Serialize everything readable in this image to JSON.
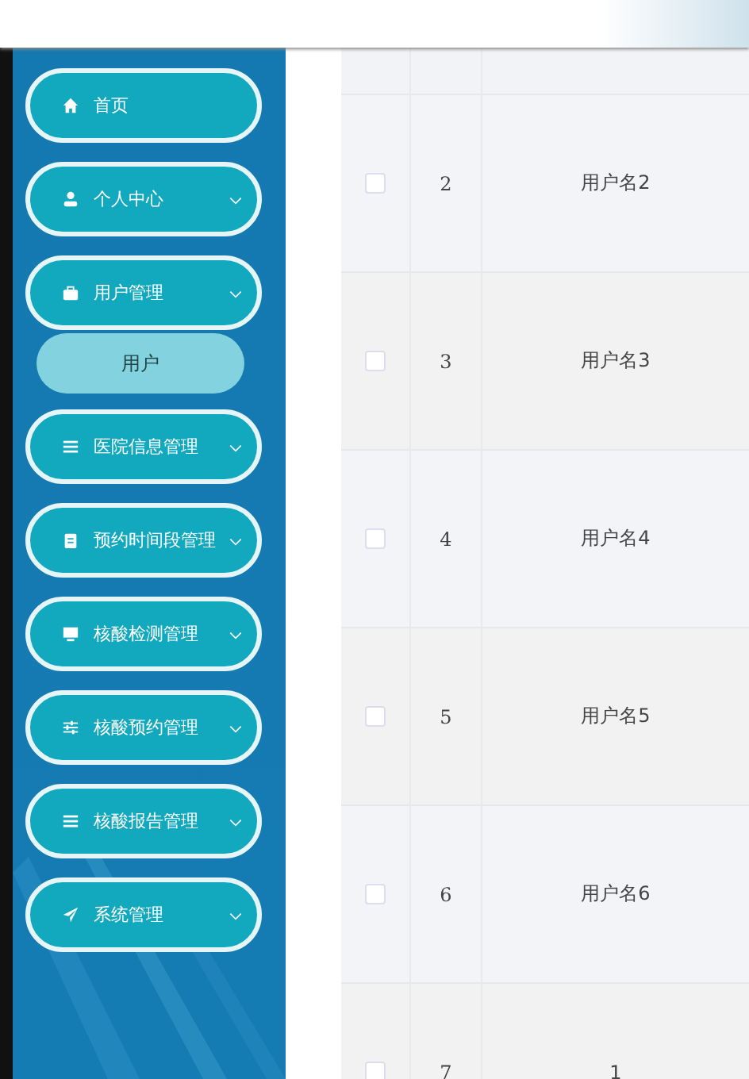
{
  "sidebar": {
    "items": [
      {
        "label": "首页",
        "kind": "link"
      },
      {
        "label": "个人中心",
        "kind": "group"
      },
      {
        "label": "用户管理",
        "kind": "group",
        "children": [
          {
            "label": "用户"
          }
        ]
      },
      {
        "label": "医院信息管理",
        "kind": "group"
      },
      {
        "label": "预约时间段管理",
        "kind": "group"
      },
      {
        "label": "核酸检测管理",
        "kind": "group"
      },
      {
        "label": "核酸预约管理",
        "kind": "group"
      },
      {
        "label": "核酸报告管理",
        "kind": "group"
      },
      {
        "label": "系统管理",
        "kind": "group"
      }
    ]
  },
  "table": {
    "rows": [
      {
        "checked": false,
        "index": "2",
        "name": "用户名2"
      },
      {
        "checked": false,
        "index": "3",
        "name": "用户名3"
      },
      {
        "checked": false,
        "index": "4",
        "name": "用户名4"
      },
      {
        "checked": false,
        "index": "5",
        "name": "用户名5"
      },
      {
        "checked": false,
        "index": "6",
        "name": "用户名6"
      },
      {
        "checked": false,
        "index": "7",
        "name": "1"
      }
    ]
  }
}
